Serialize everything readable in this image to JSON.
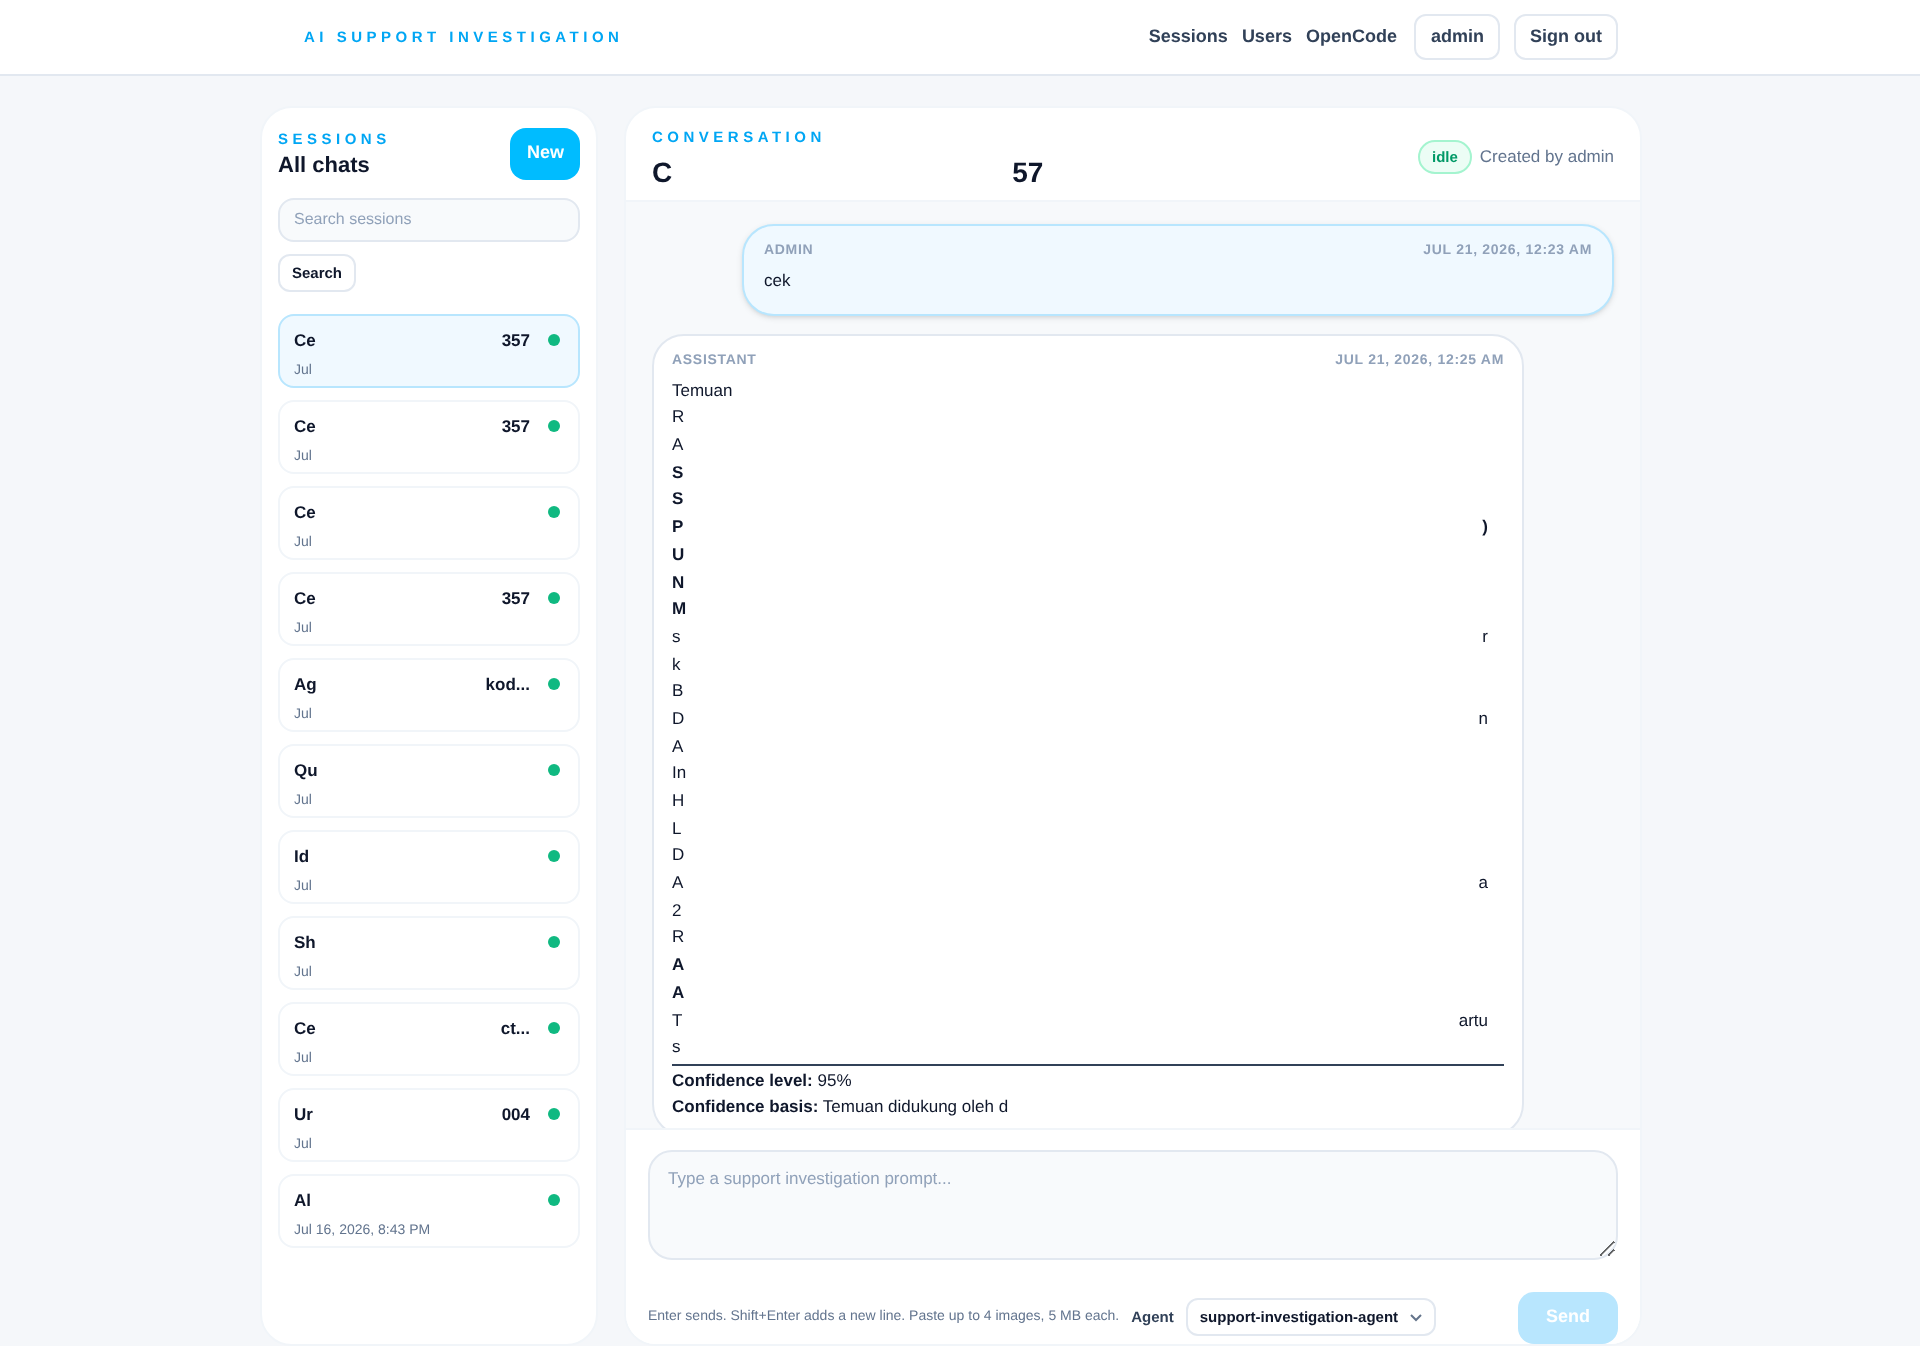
{
  "brand": "AI SUPPORT INVESTIGATION",
  "nav": {
    "links": [
      "Sessions",
      "Users",
      "OpenCode"
    ],
    "user": "admin",
    "sign_out": "Sign out"
  },
  "sidebar": {
    "eyebrow": "SESSIONS",
    "title": "All chats",
    "new_button": "New",
    "search": {
      "placeholder": "Search sessions"
    },
    "search_button": "Search",
    "items": [
      {
        "title_start": "Ce",
        "title_end": "357",
        "date": "Jul",
        "selected": true,
        "color": "#10b981"
      },
      {
        "title_start": "Ce",
        "title_end": "357",
        "date": "Jul",
        "selected": false,
        "color": "#10b981"
      },
      {
        "title_start": "Ce",
        "date": "Jul",
        "selected": false,
        "color": "#10b981"
      },
      {
        "title_start": "Ce",
        "title_end": "357",
        "date": "Jul",
        "selected": false,
        "color": "#10b981"
      },
      {
        "title_start": "Ag",
        "title_end": "kod...",
        "date": "Jul",
        "selected": false,
        "color": "#10b981"
      },
      {
        "title_start": "Qu",
        "date": "Jul",
        "selected": false,
        "color": "#10b981"
      },
      {
        "title_start": "Id",
        "date": "Jul",
        "selected": false,
        "color": "#10b981"
      },
      {
        "title_start": "Sh",
        "date": "Jul",
        "selected": false,
        "color": "#10b981"
      },
      {
        "title_start": "Ce",
        "title_end": "ct...",
        "date": "Jul",
        "selected": false,
        "color": "#10b981"
      },
      {
        "title_start": "Ur",
        "title_end": "004",
        "date": "Jul",
        "selected": false,
        "color": "#10b981"
      },
      {
        "title_start": "Al",
        "date": "Jul 16, 2026, 8:43 PM",
        "selected": false,
        "color": "#10b981"
      }
    ]
  },
  "conversation": {
    "eyebrow": "CONVERSATION",
    "title_start": "C",
    "title_end": "57",
    "status": "idle",
    "created_by": "Created by admin",
    "messages": [
      {
        "kind": "user",
        "author": "ADMIN",
        "time": "JUL 21, 2026, 12:23 AM",
        "lines": [
          {
            "start": "cek",
            "bold": false
          }
        ]
      },
      {
        "kind": "assistant",
        "author": "ASSISTANT",
        "time": "JUL 21, 2026, 12:25 AM",
        "lines": [
          {
            "start": "Temuan",
            "bold": false
          },
          {
            "start": "R",
            "bold": false
          },
          {
            "start": "A",
            "bold": false
          },
          {
            "start": "S",
            "bold": true
          },
          {
            "start": "S",
            "bold": true
          },
          {
            "start": "P",
            "end": ")",
            "bold": true
          },
          {
            "start": "U",
            "bold": true
          },
          {
            "start": "N",
            "bold": true
          },
          {
            "start": "M",
            "bold": true
          },
          {
            "start": "s",
            "end": "r",
            "bold": false
          },
          {
            "start": "k",
            "bold": false
          },
          {
            "start": "B",
            "bold": false
          },
          {
            "start": "D",
            "end": "n",
            "bold": false
          },
          {
            "start": "A",
            "bold": false
          },
          {
            "start": "In",
            "bold": false
          },
          {
            "start": "H",
            "bold": false
          },
          {
            "start": "L",
            "bold": false
          },
          {
            "start": "D",
            "bold": false
          },
          {
            "start": "A",
            "end": "a",
            "bold": false
          },
          {
            "start": "2",
            "bold": false
          },
          {
            "start": "R",
            "bold": false
          },
          {
            "start": "A",
            "bold": true
          },
          {
            "start": "A",
            "bold": true
          },
          {
            "start": "T",
            "end": "artu",
            "bold": false
          },
          {
            "start": "s",
            "bold": false
          }
        ],
        "footer": [
          "**Confidence level:** 95%",
          "**Confidence basis:** Temuan didukung oleh d"
        ]
      }
    ]
  },
  "composer": {
    "placeholder": "Type a support investigation prompt...",
    "hint": "Enter sends. Shift+Enter adds a new line. Paste up to 4 images, 5 MB each.",
    "agent_label": "Agent",
    "agent": "support-investigation-agent",
    "send": "Send",
    "send_disabled": true
  }
}
